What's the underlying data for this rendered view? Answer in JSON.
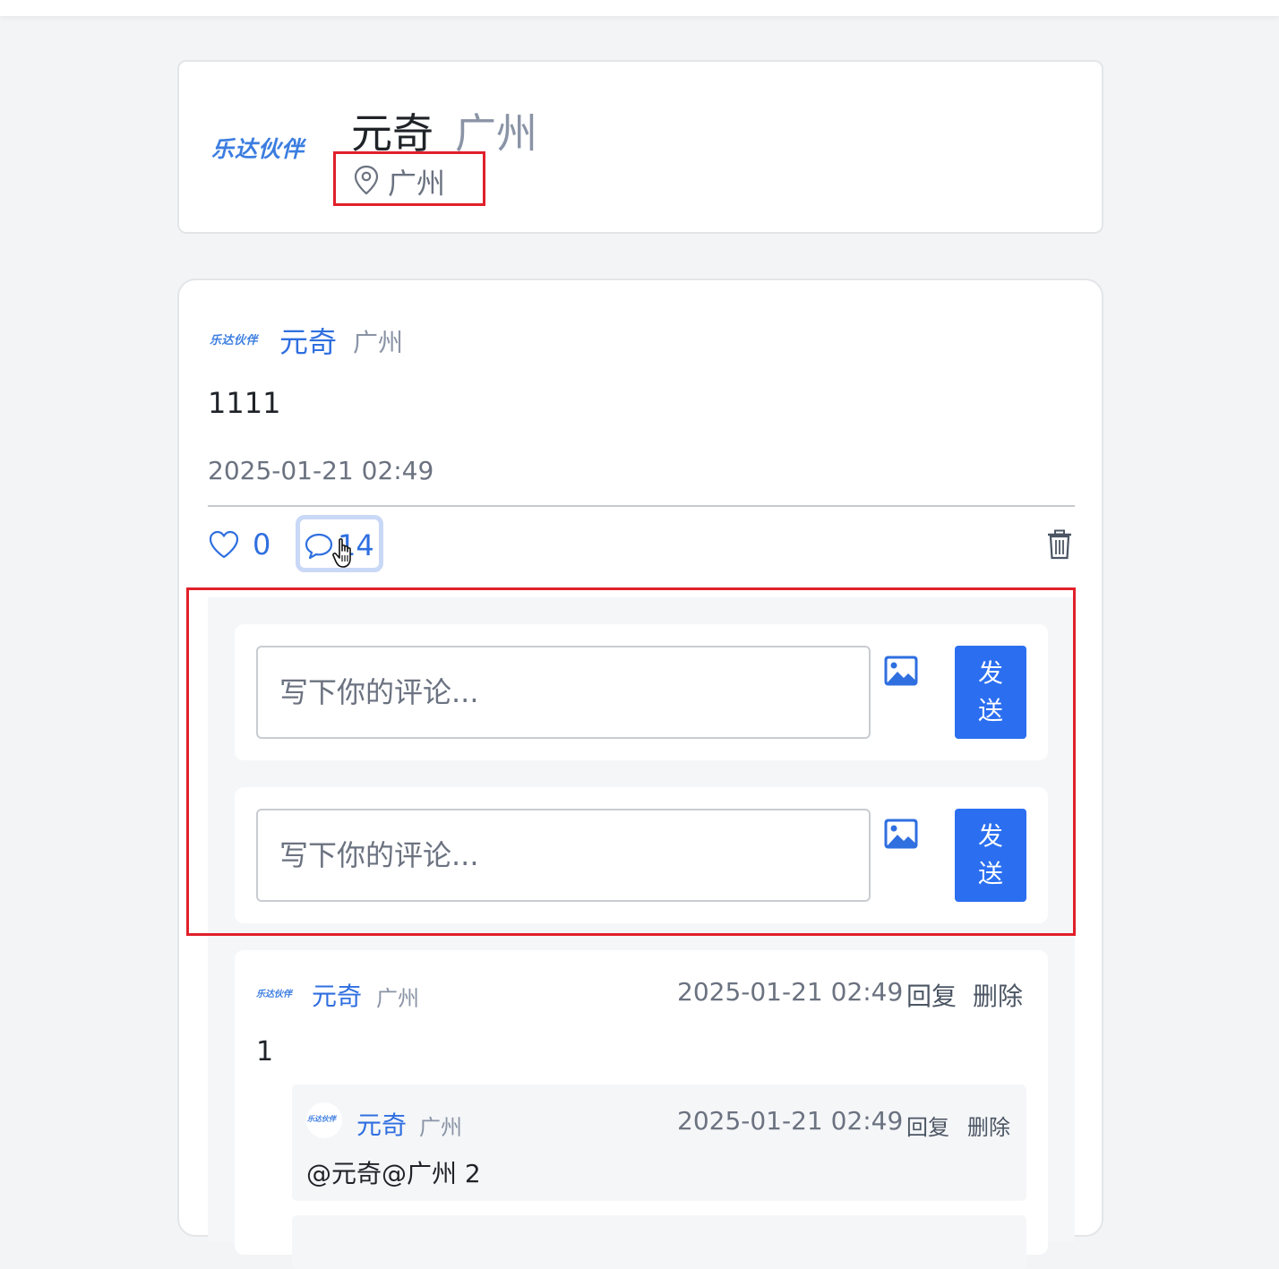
{
  "brand": {
    "logo_text": "乐达伙伴",
    "accent_color": "#2f6fe0"
  },
  "profile": {
    "name": "元奇",
    "city": "广州",
    "location_icon": "location-pin-icon",
    "location": "广州"
  },
  "post": {
    "author": {
      "name": "元奇",
      "city": "广州"
    },
    "body": "1111",
    "time": "2025-01-21 02:49",
    "likes": "0",
    "comments_count": "14",
    "icons": [
      "heart-icon",
      "comment-icon",
      "hand-cursor-icon",
      "trash-icon"
    ]
  },
  "compose": [
    {
      "placeholder": "写下你的评论...",
      "send_label": "发送",
      "icon": "image-icon"
    },
    {
      "placeholder": "写下你的评论...",
      "send_label": "发送",
      "icon": "image-icon"
    }
  ],
  "comments": [
    {
      "author": "元奇",
      "city": "广州",
      "time": "2025-01-21 02:49",
      "reply_label": "回复",
      "delete_label": "删除",
      "body": "1",
      "replies": [
        {
          "author": "元奇",
          "city": "广州",
          "time": "2025-01-21 02:49",
          "reply_label": "回复",
          "delete_label": "删除",
          "body": "@元奇@广州 2"
        }
      ]
    }
  ]
}
